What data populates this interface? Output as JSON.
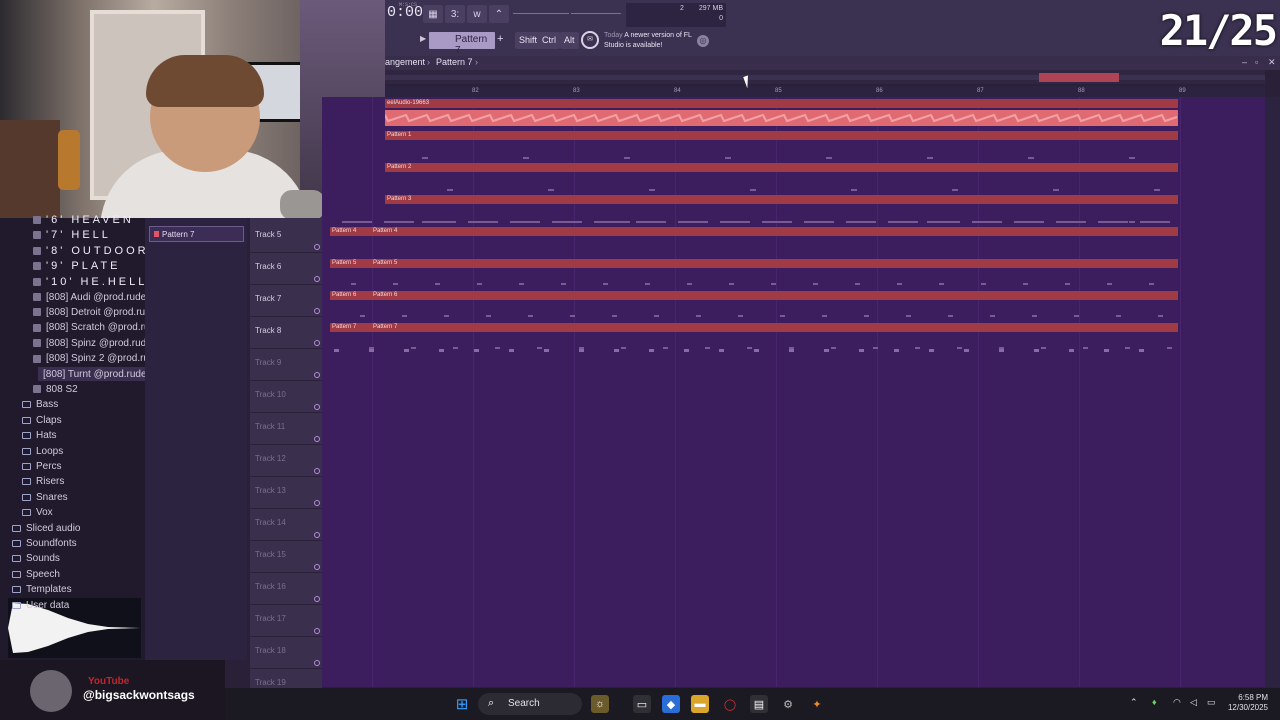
{
  "score": "21/25",
  "toolbar": {
    "time": "0:00",
    "time_label": "M:S:CS",
    "pattern": "Pattern 7",
    "modifiers": [
      "Shift",
      "Ctrl",
      "Alt"
    ],
    "cpu_value": "2",
    "ram": "297 MB",
    "ram_sub": "0",
    "news_day": "Today",
    "news_text": "A newer version of FL Studio is available!"
  },
  "breadcrumb": {
    "part1": "angement",
    "part2": "Pattern 7"
  },
  "ruler": [
    "82",
    "83",
    "84",
    "85",
    "86",
    "87",
    "88",
    "89"
  ],
  "browser": {
    "items": [
      {
        "label": "'6' HEAVEN",
        "type": "preset",
        "spaced": true
      },
      {
        "label": "'7' HELL",
        "type": "preset",
        "spaced": true
      },
      {
        "label": "'8' OUTDOOR",
        "type": "preset",
        "spaced": true
      },
      {
        "label": "'9' PLATE",
        "type": "preset",
        "spaced": true
      },
      {
        "label": "'10' HE.HELL",
        "type": "preset",
        "spaced": true
      },
      {
        "label": "[808] Audi @prod.rude",
        "type": "preset"
      },
      {
        "label": "[808] Detroit @prod.rude",
        "type": "preset"
      },
      {
        "label": "[808] Scratch @prod.rude",
        "type": "preset"
      },
      {
        "label": "[808] Spinz @prod.rude",
        "type": "preset"
      },
      {
        "label": "[808] Spinz 2 @prod.rude",
        "type": "preset"
      },
      {
        "label": "[808] Turnt @prod.rude",
        "type": "preset",
        "selected": true
      },
      {
        "label": "808 S2",
        "type": "preset"
      },
      {
        "label": "Bass",
        "type": "folder"
      },
      {
        "label": "Claps",
        "type": "folder"
      },
      {
        "label": "Hats",
        "type": "folder"
      },
      {
        "label": "Loops",
        "type": "folder"
      },
      {
        "label": "Percs",
        "type": "folder"
      },
      {
        "label": "Risers",
        "type": "folder"
      },
      {
        "label": "Snares",
        "type": "folder"
      },
      {
        "label": "Vox",
        "type": "folder"
      },
      {
        "label": "Sliced audio",
        "type": "root"
      },
      {
        "label": "Soundfonts",
        "type": "root"
      },
      {
        "label": "Sounds",
        "type": "root"
      },
      {
        "label": "Speech",
        "type": "root"
      },
      {
        "label": "Templates",
        "type": "root"
      },
      {
        "label": "User data",
        "type": "root"
      }
    ]
  },
  "picker": {
    "selected": "Pattern 7"
  },
  "tracks": [
    {
      "label": "Track 5"
    },
    {
      "label": "Track 6"
    },
    {
      "label": "Track 7"
    },
    {
      "label": "Track 8"
    },
    {
      "label": "Track 9"
    },
    {
      "label": "Track 10"
    },
    {
      "label": "Track 11"
    },
    {
      "label": "Track 12"
    },
    {
      "label": "Track 13"
    },
    {
      "label": "Track 14"
    },
    {
      "label": "Track 15"
    },
    {
      "label": "Track 16"
    },
    {
      "label": "Track 17"
    },
    {
      "label": "Track 18"
    },
    {
      "label": "Track 19"
    }
  ],
  "playlist": {
    "audio_clip": "eelAudio-19663",
    "upper_patterns": [
      "Pattern 1",
      "Pattern 2",
      "Pattern 3"
    ],
    "rows": [
      {
        "a": "Pattern 4",
        "b": "Pattern 4"
      },
      {
        "a": "Pattern 5",
        "b": "Pattern 5"
      },
      {
        "a": "Pattern 6",
        "b": "Pattern 6"
      },
      {
        "a": "Pattern 7",
        "b": "Pattern 7"
      }
    ]
  },
  "youtube": {
    "platform": "YouTube",
    "handle": "@bigsackwontsags"
  },
  "taskbar": {
    "search": "Search",
    "time": "6:58 PM",
    "date": "12/30/2025"
  },
  "colors": {
    "clip": "#a03a45",
    "playlist_bg": "#3c1d5e",
    "scroll_thumb": "#b04457"
  }
}
